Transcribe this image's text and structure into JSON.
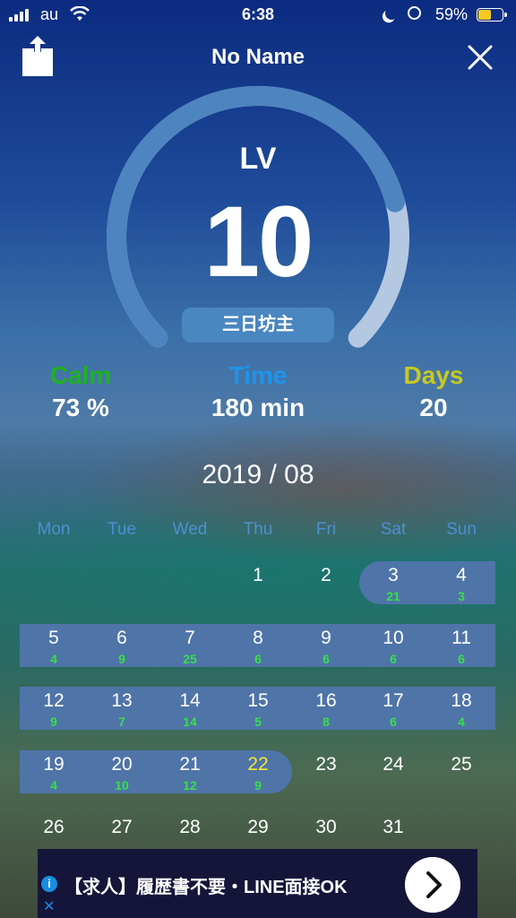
{
  "status_bar": {
    "carrier": "au",
    "time": "6:38",
    "battery_percent": "59%",
    "battery_level": 0.59
  },
  "header": {
    "title": "No Name"
  },
  "gauge": {
    "label": "LV",
    "level": "10",
    "rank": "三日坊主",
    "progress": 0.78,
    "colors": {
      "track": "#b4c8e2",
      "progress": "#4e84c0"
    }
  },
  "stats": [
    {
      "label": "Calm",
      "value": "73 %",
      "color": "#1db31d"
    },
    {
      "label": "Time",
      "value": "180 min",
      "color": "#1e94ea"
    },
    {
      "label": "Days",
      "value": "20",
      "color": "#c7c920"
    }
  ],
  "calendar": {
    "month": "2019 / 08",
    "weekdays": [
      "Mon",
      "Tue",
      "Wed",
      "Thu",
      "Fri",
      "Sat",
      "Sun"
    ],
    "weeks": [
      [
        null,
        null,
        null,
        {
          "day": "1"
        },
        {
          "day": "2"
        },
        {
          "day": "3",
          "count": "21"
        },
        {
          "day": "4",
          "count": "3"
        }
      ],
      [
        {
          "day": "5",
          "count": "4"
        },
        {
          "day": "6",
          "count": "9"
        },
        {
          "day": "7",
          "count": "25"
        },
        {
          "day": "8",
          "count": "6"
        },
        {
          "day": "9",
          "count": "6"
        },
        {
          "day": "10",
          "count": "6"
        },
        {
          "day": "11",
          "count": "6"
        }
      ],
      [
        {
          "day": "12",
          "count": "9"
        },
        {
          "day": "13",
          "count": "7"
        },
        {
          "day": "14",
          "count": "14"
        },
        {
          "day": "15",
          "count": "5"
        },
        {
          "day": "16",
          "count": "8"
        },
        {
          "day": "17",
          "count": "6"
        },
        {
          "day": "18",
          "count": "4"
        }
      ],
      [
        {
          "day": "19",
          "count": "4"
        },
        {
          "day": "20",
          "count": "10"
        },
        {
          "day": "21",
          "count": "12"
        },
        {
          "day": "22",
          "count": "9",
          "today": true
        },
        {
          "day": "23"
        },
        {
          "day": "24"
        },
        {
          "day": "25"
        }
      ],
      [
        {
          "day": "26"
        },
        {
          "day": "27"
        },
        {
          "day": "28"
        },
        {
          "day": "29"
        },
        {
          "day": "30"
        },
        {
          "day": "31"
        },
        null
      ]
    ]
  },
  "ad": {
    "text": "【求人】履歴書不要・LINE面接OK",
    "info_icon": "i",
    "close_icon": "✕"
  }
}
